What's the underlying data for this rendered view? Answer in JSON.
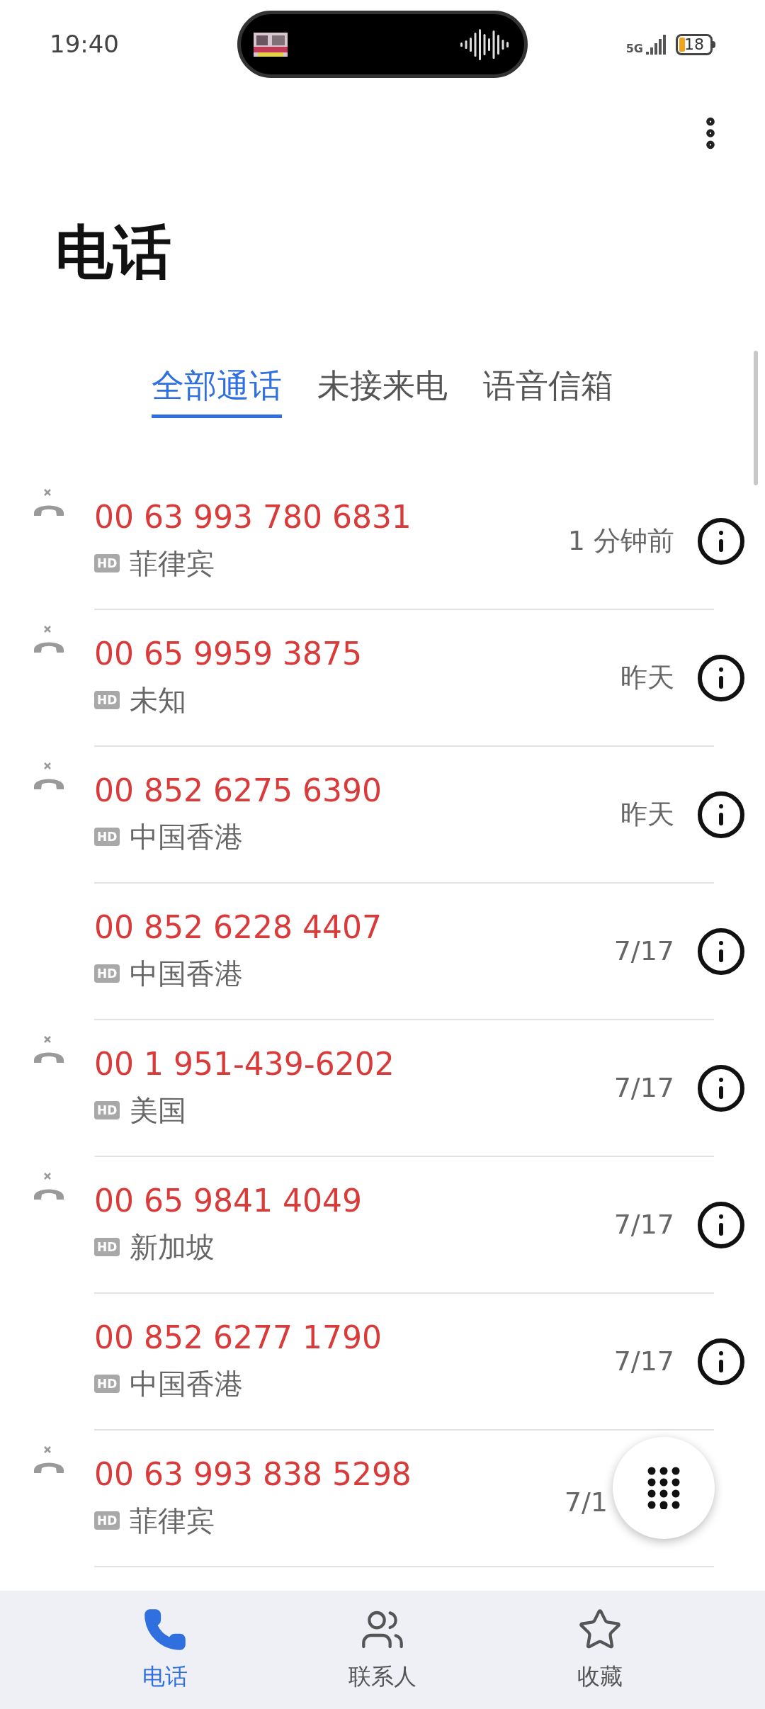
{
  "status_bar": {
    "time": "19:40",
    "network": "5G",
    "battery": "18"
  },
  "title": "电话",
  "tabs": [
    {
      "label": "全部通话",
      "selected": true
    },
    {
      "label": "未接来电",
      "selected": false
    },
    {
      "label": "语音信箱",
      "selected": false
    }
  ],
  "calls": [
    {
      "number": "00 63 993 780 6831",
      "hd": "HD",
      "location": "菲律宾",
      "time": "1 分钟前",
      "missed": true
    },
    {
      "number": "00 65 9959 3875",
      "hd": "HD",
      "location": "未知",
      "time": "昨天",
      "missed": true
    },
    {
      "number": "00 852 6275 6390",
      "hd": "HD",
      "location": "中国香港",
      "time": "昨天",
      "missed": true
    },
    {
      "number": "00 852 6228 4407",
      "hd": "HD",
      "location": "中国香港",
      "time": "7/17",
      "missed": false
    },
    {
      "number": "00 1 951-439-6202",
      "hd": "HD",
      "location": "美国",
      "time": "7/17",
      "missed": true
    },
    {
      "number": "00 65 9841 4049",
      "hd": "HD",
      "location": "新加坡",
      "time": "7/17",
      "missed": true
    },
    {
      "number": "00 852 6277 1790",
      "hd": "HD",
      "location": "中国香港",
      "time": "7/17",
      "missed": false
    },
    {
      "number": "00 63 993 838 5298",
      "hd": "HD",
      "location": "菲律宾",
      "time": "7/1",
      "missed": true
    }
  ],
  "bottom_nav": [
    {
      "label": "电话",
      "kind": "phone",
      "selected": true
    },
    {
      "label": "联系人",
      "kind": "contacts",
      "selected": false
    },
    {
      "label": "收藏",
      "kind": "star",
      "selected": false
    }
  ]
}
